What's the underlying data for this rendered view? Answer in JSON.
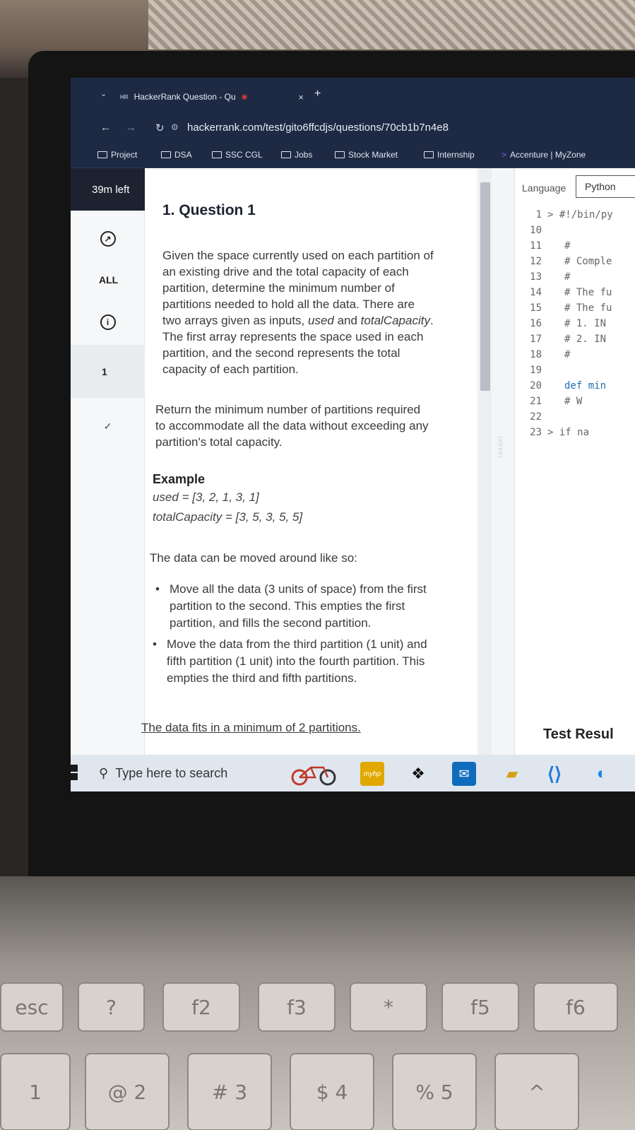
{
  "browser": {
    "tab_title": "HackerRank Question - Qu",
    "tab_logo": "HR",
    "close_glyph": "×",
    "new_tab_glyph": "+",
    "url": "hackerrank.com/test/gito6ffcdjs/questions/70cb1b7n4e8",
    "bookmarks": [
      "Project",
      "DSA",
      "SSC CGL",
      "Jobs",
      "Stock Market",
      "Internship",
      "Accenture | MyZone"
    ]
  },
  "sidebar": {
    "timer": "39m left",
    "all_label": "ALL",
    "info_glyph": "i",
    "question_number": "1",
    "check_glyph": "✓"
  },
  "question": {
    "title": "1. Question 1",
    "para1_lines": [
      "Given the space currently used on each partition of",
      "an existing drive and the total capacity of each",
      "partition, determine the minimum number of",
      "partitions needed to hold all the data. There are"
    ],
    "para1_line5_a": "two arrays given as inputs, ",
    "para1_line5_used": "used",
    "para1_line5_b": " and ",
    "para1_line5_total": "totalCapacity",
    "para1_line5_c": ".",
    "para1_tail": [
      "The first array represents the space used in each",
      "partition, and the second represents the total",
      "capacity of each partition."
    ],
    "para2_lines": [
      "Return the minimum number of partitions required",
      "to accommodate all the data without exceeding any",
      "partition's total capacity."
    ],
    "example_heading": "Example",
    "example_used": "used = [3, 2, 1, 3, 1]",
    "example_total": "totalCapacity = [3, 5, 3, 5, 5]",
    "moved_intro": "The data can be moved around like so:",
    "bullet1": [
      "Move all the data (3 units of space) from the first",
      "partition to the second. This empties the first",
      "partition, and fills the second partition."
    ],
    "bullet2": [
      "Move the data from the third partition (1 unit) and",
      "fifth partition (1 unit) into the fourth partition. This",
      "empties the third and fifth partitions."
    ],
    "footer_line": "The data fits in a minimum of 2 partitions."
  },
  "editor": {
    "language_label": "Language",
    "language_value": "Python",
    "lines": [
      {
        "n": "1",
        "code": "> #!/bin/py"
      },
      {
        "n": "10",
        "code": ""
      },
      {
        "n": "11",
        "code": "#"
      },
      {
        "n": "12",
        "code": "# Comple"
      },
      {
        "n": "13",
        "code": "#"
      },
      {
        "n": "14",
        "code": "# The fu"
      },
      {
        "n": "15",
        "code": "# The fu"
      },
      {
        "n": "16",
        "code": "#   1. IN"
      },
      {
        "n": "17",
        "code": "#   2. IN"
      },
      {
        "n": "18",
        "code": "#"
      },
      {
        "n": "19",
        "code": ""
      },
      {
        "n": "20",
        "code": "def min"
      },
      {
        "n": "21",
        "code": "    # W"
      },
      {
        "n": "22",
        "code": ""
      },
      {
        "n": "23",
        "code": "> if   na"
      }
    ],
    "test_results": "Test Resul"
  },
  "taskbar": {
    "search_placeholder": "Type here to search",
    "myhp_label": "myhp"
  },
  "keyboard": {
    "fn_keys": [
      "esc",
      "?",
      "f2",
      "f3",
      "*",
      "f5",
      "f6"
    ],
    "num_keys": [
      "1",
      "@ 2",
      "# 3",
      "$ 4",
      "% 5",
      "^"
    ]
  }
}
